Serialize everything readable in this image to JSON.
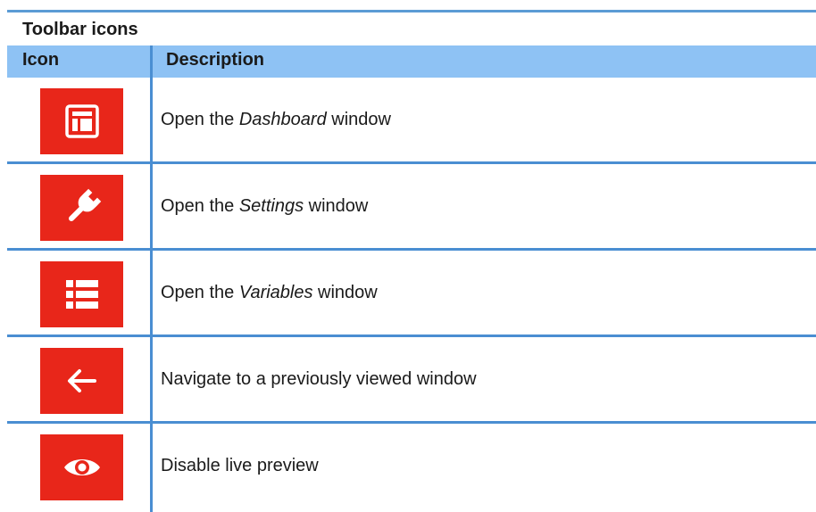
{
  "table": {
    "title": "Toolbar icons",
    "headers": {
      "icon": "Icon",
      "description": "Description"
    },
    "rows": [
      {
        "icon": "dashboard-icon",
        "desc_pre": "Open the ",
        "desc_em": "Dashboard",
        "desc_post": " window"
      },
      {
        "icon": "wrench-icon",
        "desc_pre": "Open the ",
        "desc_em": "Settings",
        "desc_post": " window"
      },
      {
        "icon": "list-icon",
        "desc_pre": "Open the ",
        "desc_em": "Variables",
        "desc_post": " window"
      },
      {
        "icon": "back-arrow-icon",
        "desc_pre": "Navigate to a previously viewed window",
        "desc_em": "",
        "desc_post": ""
      },
      {
        "icon": "eye-icon",
        "desc_pre": "Disable live preview",
        "desc_em": "",
        "desc_post": ""
      }
    ]
  },
  "colors": {
    "icon_background": "#e8261a",
    "header_background": "#8ec2f4",
    "rule_color": "#4a8ed2"
  }
}
